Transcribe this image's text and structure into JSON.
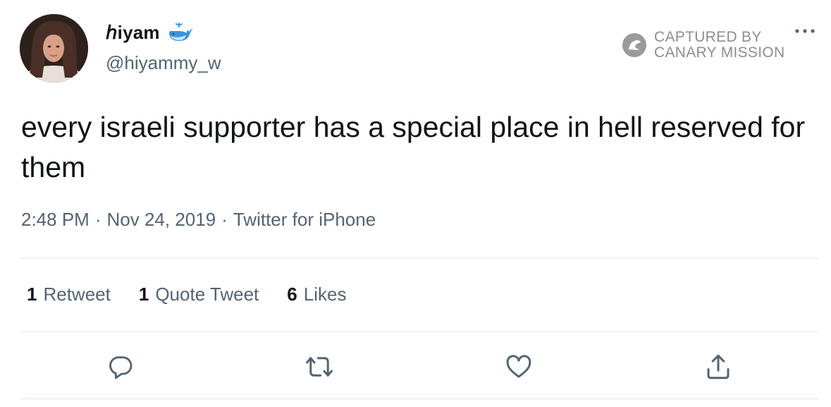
{
  "author": {
    "display_name": "ℎiyam",
    "handle": "@hiyammy_w",
    "name_emoji": "whale-icon"
  },
  "watermark": {
    "line1": "CAPTURED BY",
    "line2": "CANARY MISSION",
    "icon": "canary-bird-icon"
  },
  "tweet": {
    "text": "every israeli supporter has a special place in hell reserved for them",
    "time": "2:48 PM",
    "separator": "·",
    "date": "Nov 24, 2019",
    "source": "Twitter for iPhone"
  },
  "stats": [
    {
      "count": "1",
      "label": "Retweet"
    },
    {
      "count": "1",
      "label": "Quote Tweet"
    },
    {
      "count": "6",
      "label": "Likes"
    }
  ],
  "actions": [
    "reply-icon",
    "retweet-icon",
    "like-icon",
    "share-icon"
  ],
  "colors": {
    "text": "#0f1419",
    "secondary": "#536471",
    "divider": "#e1e8ed",
    "whale": "#3b94d9",
    "watermark": "#8e8e8e"
  }
}
